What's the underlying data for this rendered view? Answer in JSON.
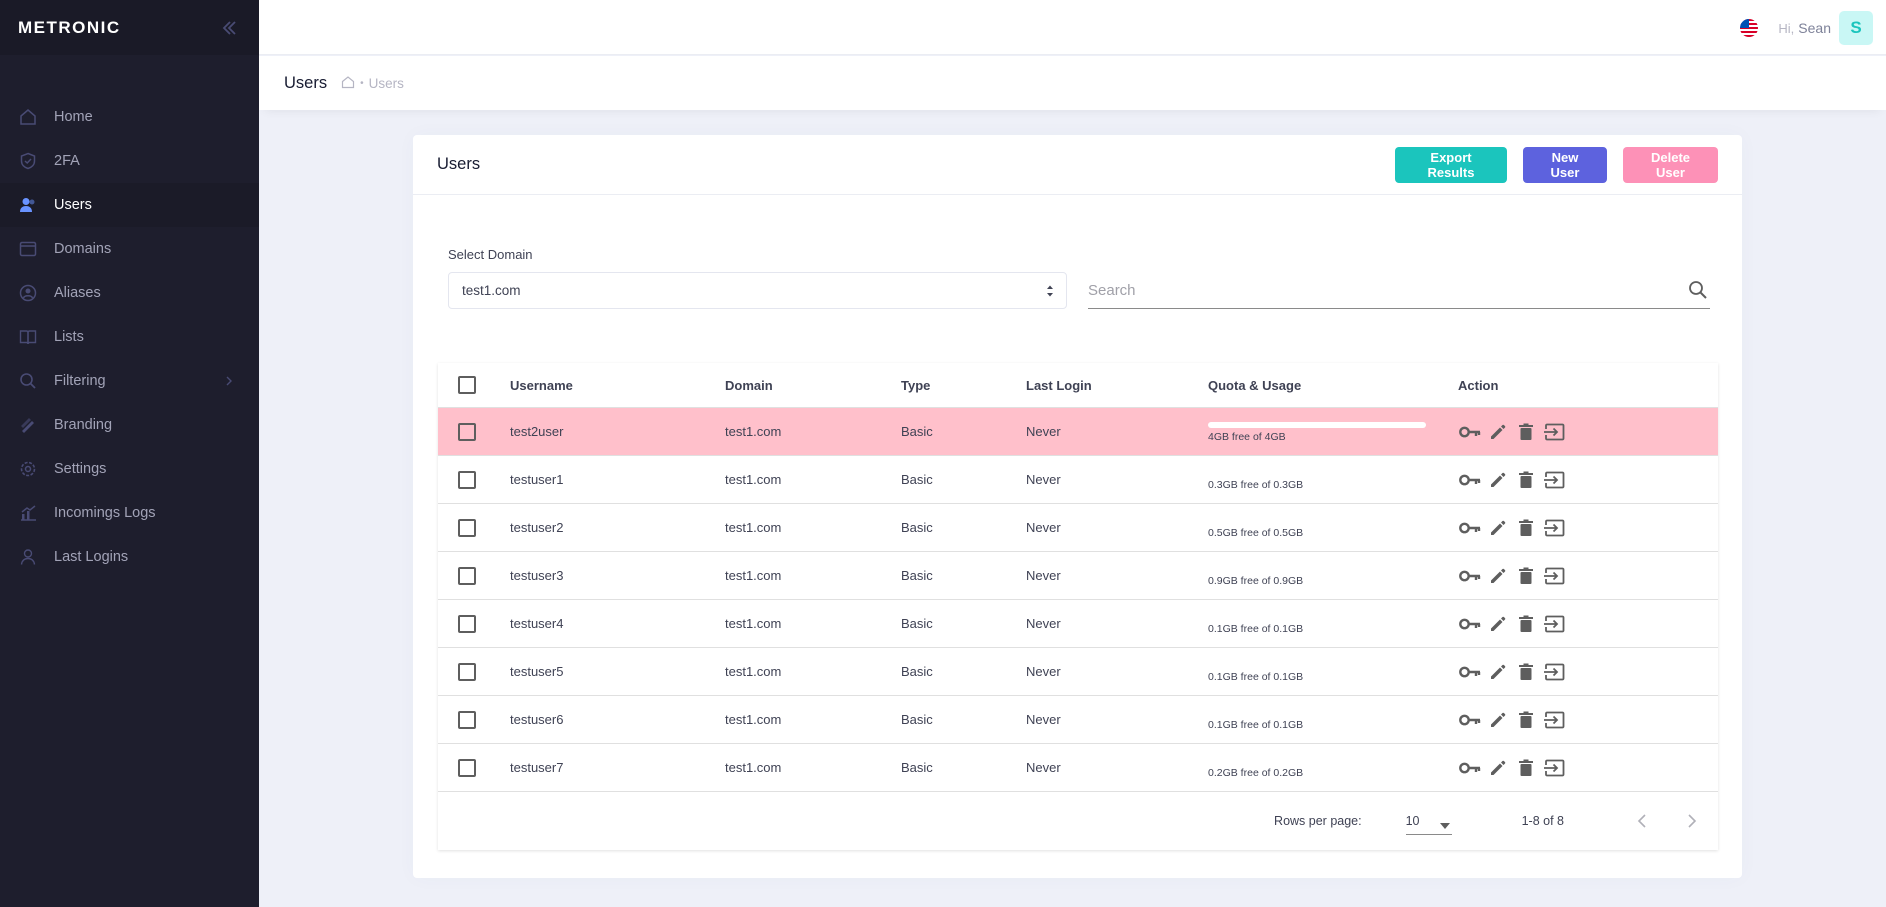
{
  "brand": {
    "name": "METRONIC"
  },
  "sidebar": {
    "items": [
      {
        "label": "Home",
        "icon": "home-icon",
        "active": false
      },
      {
        "label": "2FA",
        "icon": "shield-icon",
        "active": false
      },
      {
        "label": "Users",
        "icon": "users-icon",
        "active": true
      },
      {
        "label": "Domains",
        "icon": "window-icon",
        "active": false
      },
      {
        "label": "Aliases",
        "icon": "alias-icon",
        "active": false
      },
      {
        "label": "Lists",
        "icon": "book-icon",
        "active": false
      },
      {
        "label": "Filtering",
        "icon": "search-icon",
        "active": false,
        "has_children": true
      },
      {
        "label": "Branding",
        "icon": "brush-icon",
        "active": false
      },
      {
        "label": "Settings",
        "icon": "gear-icon",
        "active": false
      },
      {
        "label": "Incomings Logs",
        "icon": "chart-icon",
        "active": false
      },
      {
        "label": "Last Logins",
        "icon": "user-outline-icon",
        "active": false
      }
    ]
  },
  "header": {
    "greeting": "Hi,",
    "user_name": "Sean",
    "avatar_letter": "S"
  },
  "subheader": {
    "title": "Users",
    "breadcrumb": [
      "Users"
    ]
  },
  "card": {
    "title": "Users",
    "buttons": {
      "export": "Export Results",
      "new": "New User",
      "delete": "Delete User"
    }
  },
  "filters": {
    "domain_label": "Select Domain",
    "domain_value": "test1.com",
    "search_placeholder": "Search"
  },
  "table": {
    "columns": [
      "Username",
      "Domain",
      "Type",
      "Last Login",
      "Quota & Usage",
      "Action"
    ],
    "rows": [
      {
        "username": "test2user",
        "domain": "test1.com",
        "type": "Basic",
        "last_login": "Never",
        "quota": "4GB free of 4GB",
        "selected": true
      },
      {
        "username": "testuser1",
        "domain": "test1.com",
        "type": "Basic",
        "last_login": "Never",
        "quota": "0.3GB free of 0.3GB",
        "selected": false
      },
      {
        "username": "testuser2",
        "domain": "test1.com",
        "type": "Basic",
        "last_login": "Never",
        "quota": "0.5GB free of 0.5GB",
        "selected": false
      },
      {
        "username": "testuser3",
        "domain": "test1.com",
        "type": "Basic",
        "last_login": "Never",
        "quota": "0.9GB free of 0.9GB",
        "selected": false
      },
      {
        "username": "testuser4",
        "domain": "test1.com",
        "type": "Basic",
        "last_login": "Never",
        "quota": "0.1GB free of 0.1GB",
        "selected": false
      },
      {
        "username": "testuser5",
        "domain": "test1.com",
        "type": "Basic",
        "last_login": "Never",
        "quota": "0.1GB free of 0.1GB",
        "selected": false
      },
      {
        "username": "testuser6",
        "domain": "test1.com",
        "type": "Basic",
        "last_login": "Never",
        "quota": "0.1GB free of 0.1GB",
        "selected": false
      },
      {
        "username": "testuser7",
        "domain": "test1.com",
        "type": "Basic",
        "last_login": "Never",
        "quota": "0.2GB free of 0.2GB",
        "selected": false
      }
    ],
    "footer": {
      "rows_per_page_label": "Rows per page:",
      "rows_per_page": "10",
      "range": "1-8 of 8"
    }
  },
  "colors": {
    "sidebar_bg": "#1e1e2d",
    "export": "#1bc5bd",
    "new": "#5d62de",
    "delete": "#fd91b7",
    "selected_row": "#ffc0cb"
  }
}
